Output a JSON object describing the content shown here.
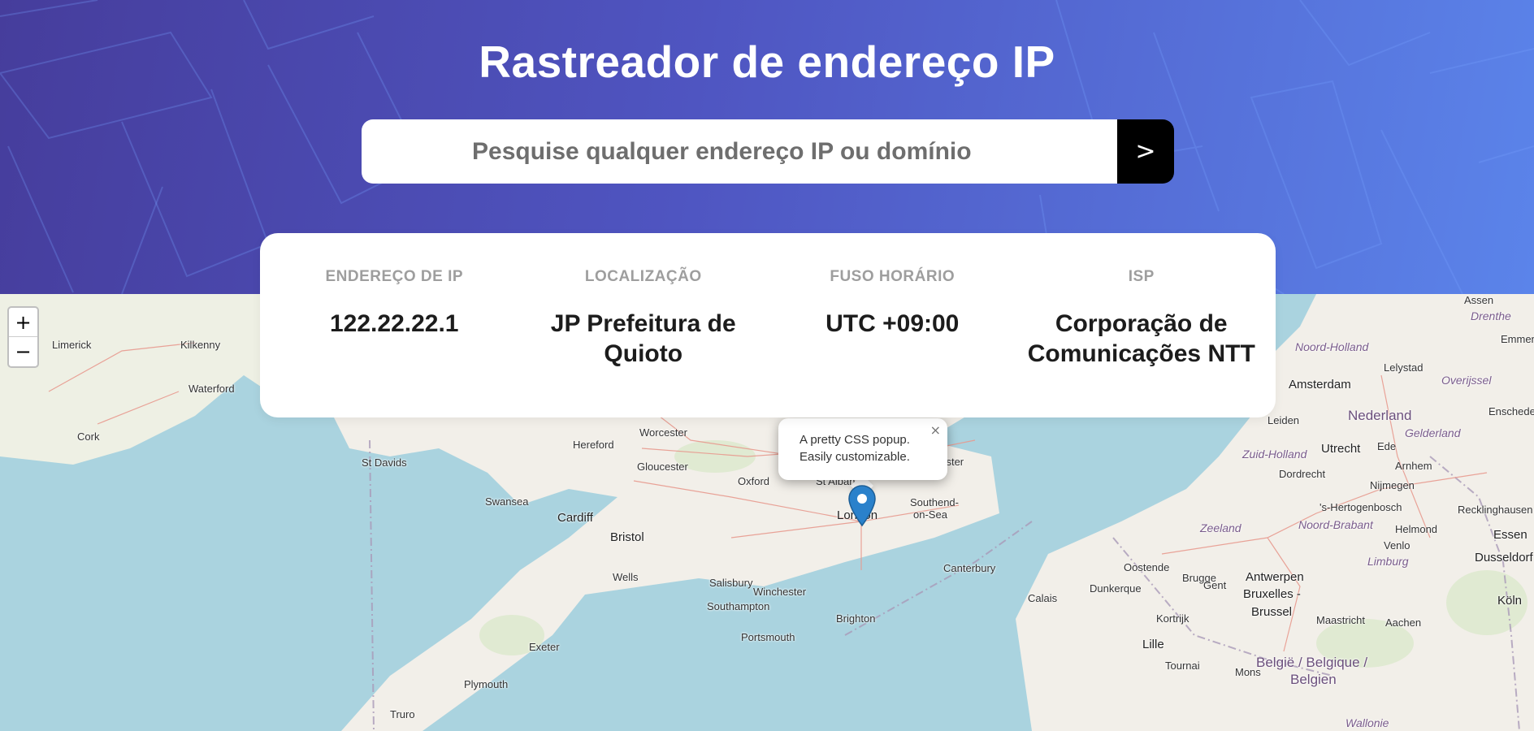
{
  "header": {
    "title": "Rastreador de endereço IP",
    "background_gradient": [
      "#463d9c",
      "#5b84ea"
    ]
  },
  "search": {
    "placeholder": "Pesquise qualquer endereço IP ou domínio",
    "value": "",
    "button_label": ">"
  },
  "info": [
    {
      "label": "ENDEREÇO DE IP",
      "value": "122.22.22.1"
    },
    {
      "label": "LOCALIZAÇÃO",
      "value": "JP Prefeitura de Quioto"
    },
    {
      "label": "FUSO HORÁRIO",
      "value": "UTC +09:00"
    },
    {
      "label": "ISP",
      "value": "Corporação de Comunicações NTT"
    }
  ],
  "map": {
    "zoom_in": "+",
    "zoom_out": "−",
    "popup_line1": "A pretty CSS popup.",
    "popup_line2": "Easily customizable.",
    "popup_close": "×",
    "marker_color": "#2a81cb",
    "labels": {
      "limerick": "Limerick",
      "kilkenny": "Kilkenny",
      "waterford": "Waterford",
      "cork": "Cork",
      "st_davids": "St Davids",
      "swansea": "Swansea",
      "cardiff": "Cardiff",
      "bristol": "Bristol",
      "wells": "Wells",
      "exeter": "Exeter",
      "plymouth": "Plymouth",
      "truro": "Truro",
      "worcester": "Worcester",
      "hereford": "Hereford",
      "gloucester": "Gloucester",
      "oxford": "Oxford",
      "st_albans": "St Alban",
      "london": "London",
      "southend": "Southend-",
      "on_sea": "on-Sea",
      "chester": "hester",
      "salisbury": "Salisbury",
      "winchester": "Winchester",
      "southampton": "Southampton",
      "portsmouth": "Portsmouth",
      "brighton": "Brighton",
      "canterbury": "Canterbury",
      "calais": "Calais",
      "dunkerque": "Dunkerque",
      "oostende": "Oostende",
      "brugge": "Brugge",
      "gent": "Gent",
      "kortrijk": "Kortrijk",
      "lille": "Lille",
      "tournai": "Tournai",
      "mons": "Mons",
      "antwerpen": "Antwerpen",
      "bruxelles1": "Bruxelles -",
      "bruxelles2": "Brussel",
      "maastricht": "Maastricht",
      "aachen": "Aachen",
      "belgie1": "België / Belgique /",
      "belgie2": "Belgien",
      "wallonie": "Wallonie",
      "koln": "Köln",
      "essen": "Essen",
      "dusseldorf": "Dusseldorf",
      "venlo": "Venlo",
      "helmond": "Helmond",
      "limburg": "Limburg",
      "noord_brabant": "Noord-Brabant",
      "zeeland": "Zeeland",
      "hertogenbosch": "'s-Hertogenbosch",
      "nijmegen": "Nijmegen",
      "arnhem": "Arnhem",
      "recklinghausen": "Recklinghausen",
      "dordrecht": "Dordrecht",
      "zuid_holland": "Zuid-Holland",
      "utrecht": "Utrecht",
      "ede": "Ede",
      "gelderland": "Gelderland",
      "nederland": "Nederland",
      "leiden": "Leiden",
      "amsterdam": "Amsterdam",
      "noord_holland": "Noord-Holland",
      "lelystad": "Lelystad",
      "overijssel": "Overijssel",
      "drenthe": "Drenthe",
      "emmen": "Emmen",
      "assen": "Assen",
      "enschede": "Enschede"
    }
  }
}
